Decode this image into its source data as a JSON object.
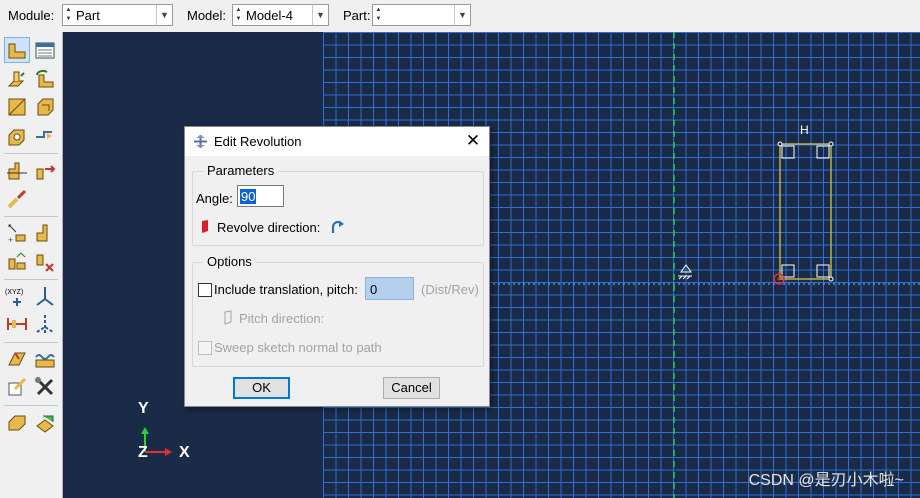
{
  "context_bar": {
    "module_label": "Module:",
    "module_value": "Part",
    "model_label": "Model:",
    "model_value": "Model-4",
    "part_label": "Part:",
    "part_value": ""
  },
  "viewport": {
    "sketch_label_h": "H",
    "triad": {
      "y": "Y",
      "z": "Z",
      "x": "X"
    },
    "watermark": "CSDN @是刃小木啦~",
    "colors": {
      "background": "#1a2b48",
      "grid": "#2f6fd6",
      "axis": "#2ecc40",
      "profile": "#e6d23a"
    }
  },
  "dialog": {
    "title": "Edit Revolution",
    "parameters_group": "Parameters",
    "angle_label": "Angle:",
    "angle_value": "90",
    "revolve_direction_label": "Revolve direction:",
    "options_group": "Options",
    "include_translation_label": "Include translation, pitch:",
    "pitch_value": "0",
    "pitch_units": "(Dist/Rev)",
    "pitch_direction_label": "Pitch direction:",
    "sweep_label": "Sweep sketch normal to path",
    "ok_label": "OK",
    "cancel_label": "Cancel",
    "close_symbol": "✕"
  },
  "toolbox": {
    "icons": [
      "create-part-icon",
      "part-manager-icon",
      "create-solid-extrude-icon",
      "create-solid-revolve-icon",
      "create-shell-icon",
      "create-solid-sweep-icon",
      "create-cut-icon",
      "create-round-icon",
      "create-partition-icon",
      "create-datum-icon",
      "virtual-topology-icon",
      "repair-icon",
      "query-icon",
      "set-icon",
      "create-point-icon",
      "create-axis-icon",
      "create-plane-icon",
      "csys-icon",
      "sketch-icon",
      "wire-icon",
      "attach-icon",
      "tools-icon",
      "merge-icon",
      "surface-icon"
    ]
  }
}
